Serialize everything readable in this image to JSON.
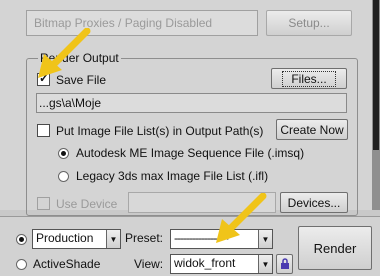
{
  "top": {
    "bitmap_label": "Bitmap Proxies / Paging Disabled",
    "setup_button": "Setup..."
  },
  "render_output": {
    "group_label": "Render Output",
    "save_file_label": "Save File",
    "save_file_checked": true,
    "files_button": "Files...",
    "path_value": "...gs\\a\\Moje",
    "put_image_label": "Put Image File List(s) in Output Path(s)",
    "create_now_button": "Create Now",
    "radio_autodesk_label": "Autodesk ME Image Sequence File (.imsq)",
    "radio_legacy_label": "Legacy 3ds max Image File List (.ifl)",
    "use_device_label": "Use Device",
    "devices_button": "Devices..."
  },
  "bottom": {
    "production_select": "Production",
    "activeshade_label": "ActiveShade",
    "preset_label": "Preset:",
    "preset_value": "------------------",
    "view_label": "View:",
    "view_value": "widok_front",
    "render_button": "Render"
  },
  "colors": {
    "arrow": "#f0c419",
    "lock_icon": "#4b3bb0"
  }
}
